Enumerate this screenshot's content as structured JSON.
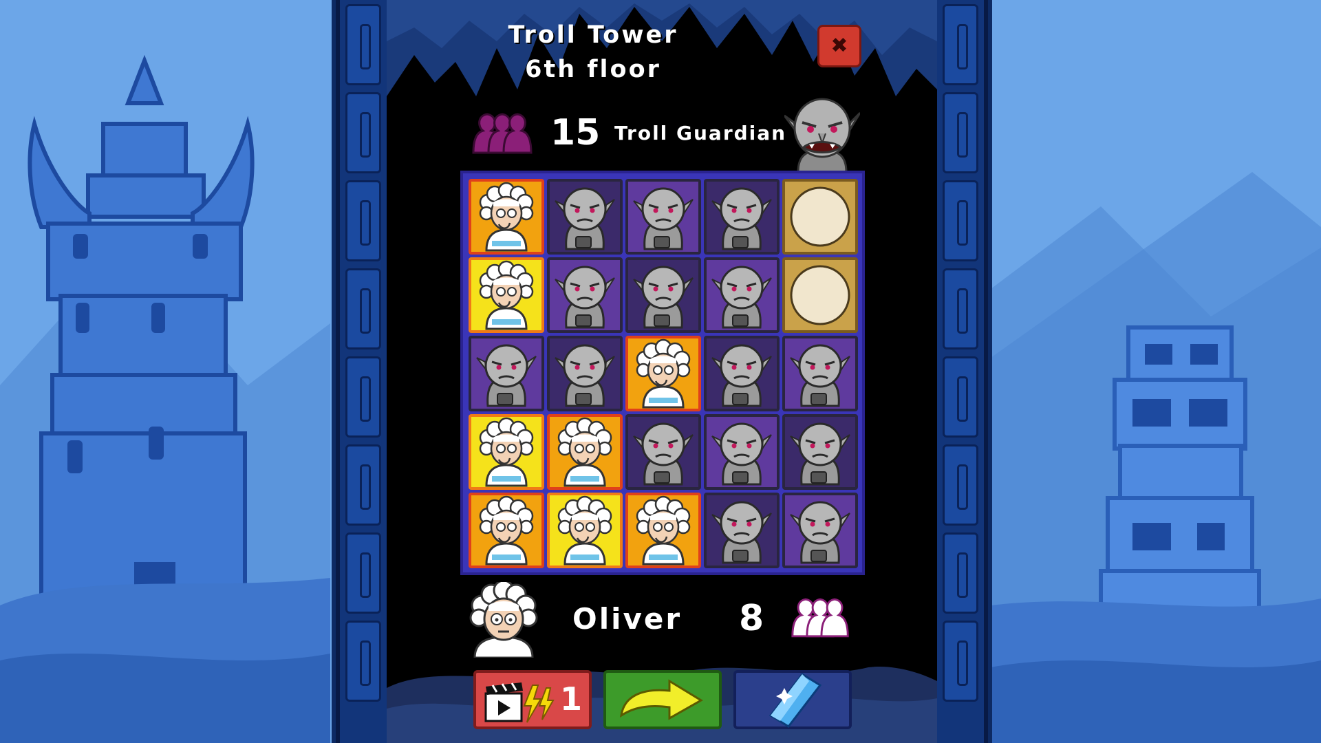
{
  "title": {
    "line1": "Troll Tower",
    "line2": "6th floor"
  },
  "close": {
    "icon": "close-x-icon",
    "symbol": "✖"
  },
  "enemy": {
    "lives": "15",
    "name": "Troll Guardian",
    "lives_icon": "crowd-silhouette-icon",
    "avatar": "troll-guardian-avatar"
  },
  "board": {
    "size": 5,
    "cells": [
      [
        "player",
        "troll",
        "troll",
        "troll",
        "empty"
      ],
      [
        "player",
        "troll",
        "troll",
        "troll",
        "empty"
      ],
      [
        "troll",
        "troll",
        "player",
        "troll",
        "troll"
      ],
      [
        "player",
        "player",
        "troll",
        "troll",
        "troll"
      ],
      [
        "player",
        "player",
        "player",
        "troll",
        "troll"
      ]
    ]
  },
  "player": {
    "name": "Oliver",
    "lives": "8",
    "lives_icon": "crowd-silhouette-icon",
    "avatar": "old-scientist-avatar"
  },
  "actions": {
    "video": {
      "icon": "clapperboard-lightning-icon",
      "count": "1"
    },
    "skip": {
      "icon": "curved-arrow-icon"
    },
    "gem": {
      "icon": "blue-crystal-icon"
    }
  },
  "colors": {
    "panel": "#0d2a63",
    "board": "#3a35b8",
    "player_tile": "#f2a20f",
    "troll_tile": "#5f3a9e",
    "enemy_lives": "#8b1f78",
    "player_lives": "#ffffff"
  }
}
